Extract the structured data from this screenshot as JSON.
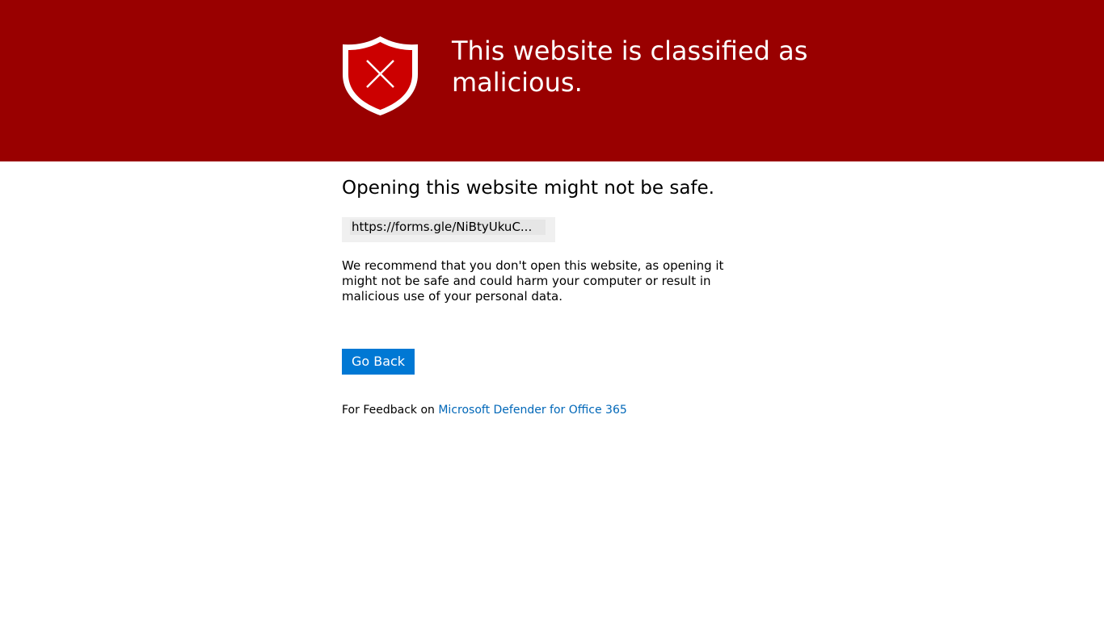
{
  "banner": {
    "title": "This website is classified as malicious.",
    "icon": "shield-x-icon",
    "background_color": "#990000",
    "shield_color": "#cc0000"
  },
  "main": {
    "subtitle": "Opening this website might not be safe.",
    "url": "https://forms.gle/NiBtyUkuC...",
    "description": "We recommend that you don't open this website, as opening it might not be safe and could harm your computer or result in malicious use of your personal data.",
    "go_back_label": "Go Back",
    "button_color": "#0078d4"
  },
  "feedback": {
    "prefix": "For Feedback on",
    "link_text": "Microsoft Defender for Office 365",
    "link_color": "#0067b8"
  }
}
